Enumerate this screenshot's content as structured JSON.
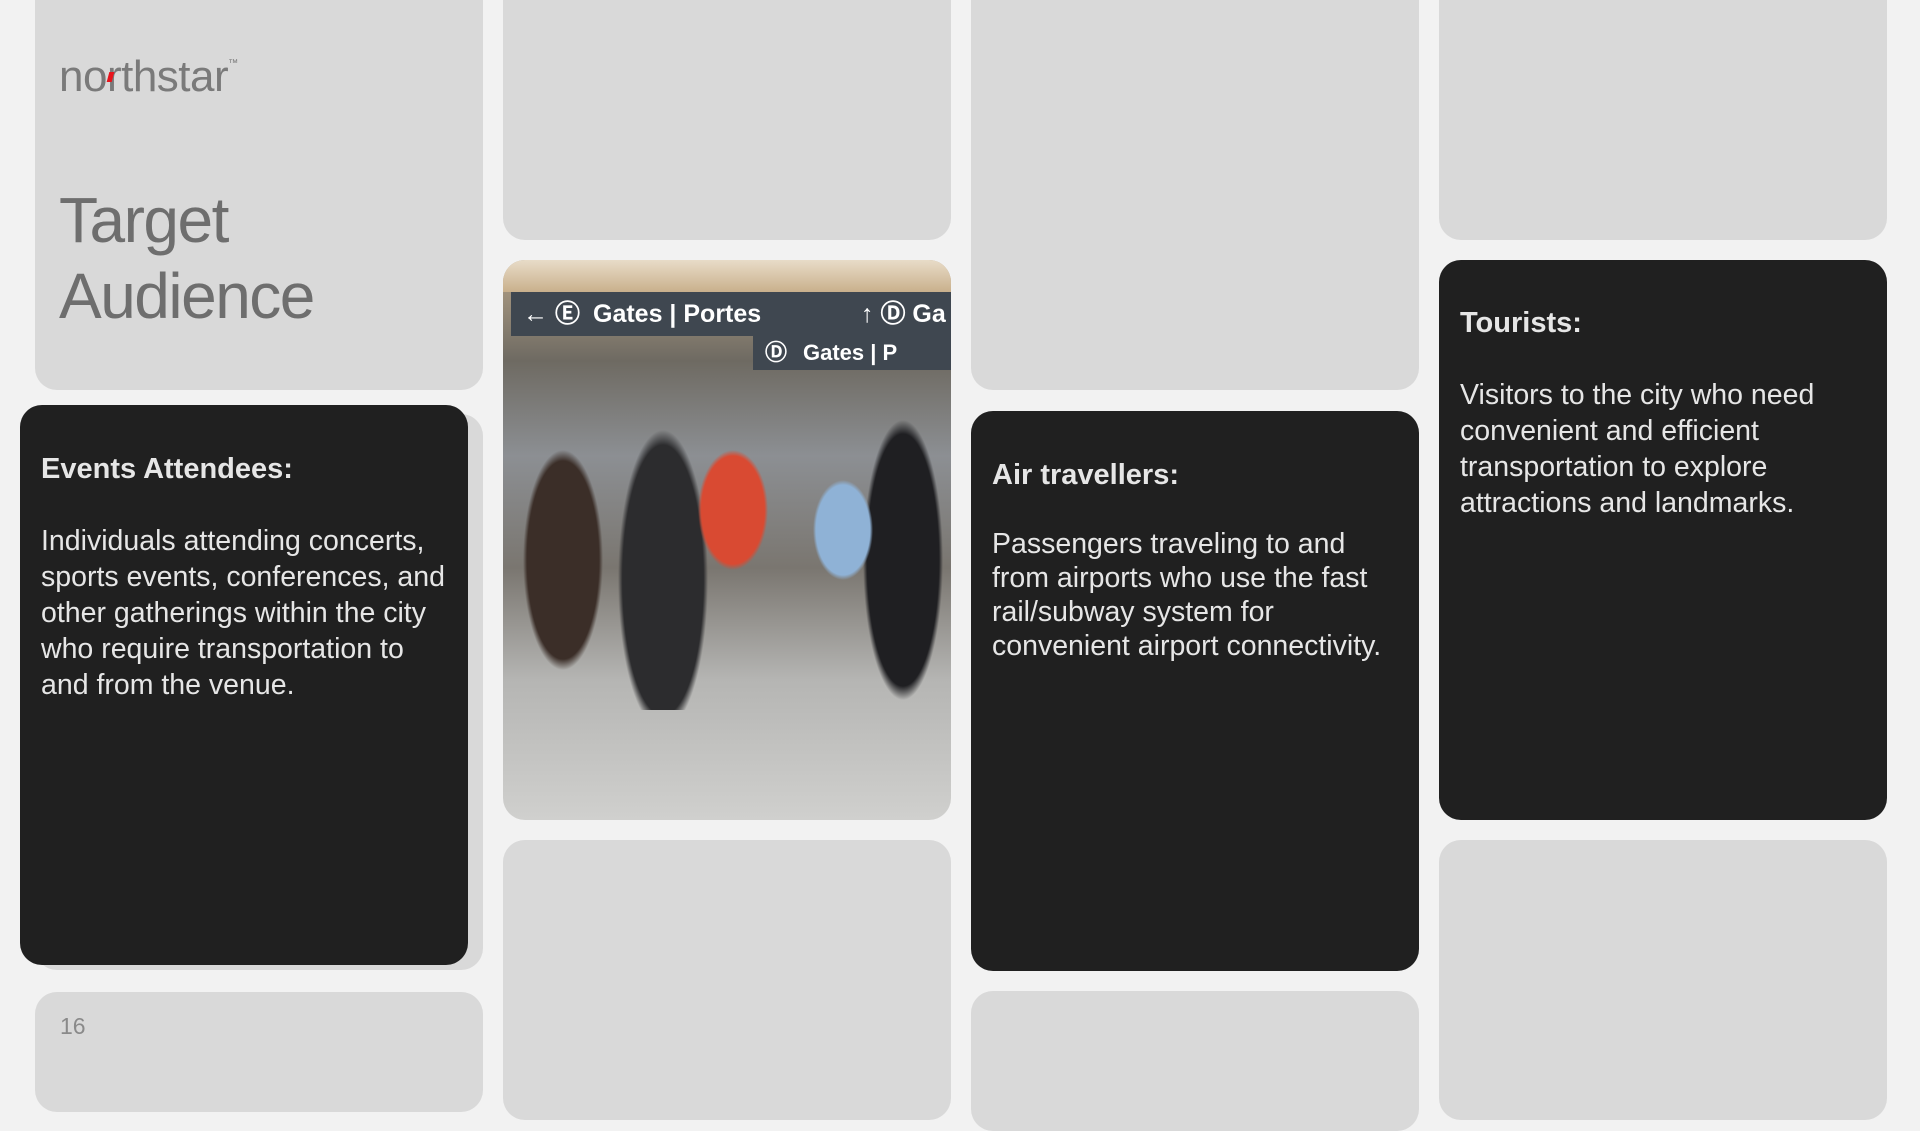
{
  "brand": {
    "logo_text": "northstar",
    "trademark": "™"
  },
  "slide": {
    "title_line1": "Target",
    "title_line2": "Audience",
    "page_number": "16"
  },
  "photo": {
    "description_alt": "Airport travellers queuing",
    "sign_main": "Gates | Portes",
    "sign_secondary": "Gates | P"
  },
  "audiences": [
    {
      "heading": "Events Attendees:",
      "body": "Individuals attending concerts, sports events, conferences, and other gatherings within the city who require transportation to and from the venue."
    },
    {
      "heading": "Air travellers:",
      "body": "Passengers traveling to and from airports who use the fast rail/subway system for convenient airport connectivity."
    },
    {
      "heading": "Tourists:",
      "body": "Visitors to the city who need convenient and efficient transportation to explore attractions and landmarks."
    }
  ]
}
